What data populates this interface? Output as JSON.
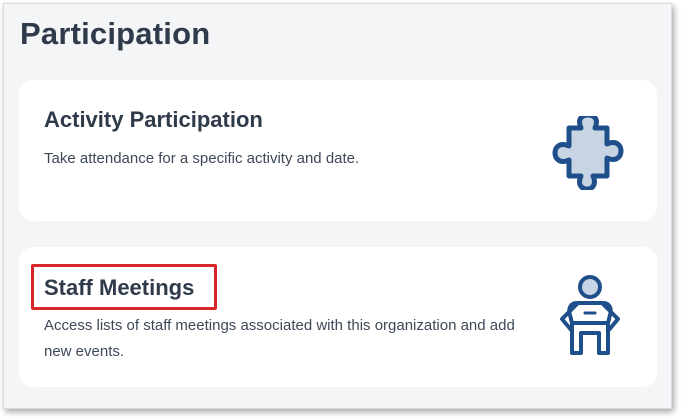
{
  "page": {
    "title": "Participation"
  },
  "cards": [
    {
      "title": "Activity Participation",
      "description": "Take attendance for a specific activity and date.",
      "icon": "puzzle-piece-icon"
    },
    {
      "title": "Staff Meetings",
      "description": "Access lists of staff meetings associated with this organization and add new events.",
      "icon": "staff-person-icon",
      "highlighted": true
    }
  ],
  "colors": {
    "heading": "#2f3a4a",
    "text": "#3d4858",
    "icon_stroke": "#1f4f8a",
    "icon_fill": "#c6d4e3",
    "highlight": "#d9262a",
    "background": "#f4f5f7",
    "card": "#ffffff"
  }
}
